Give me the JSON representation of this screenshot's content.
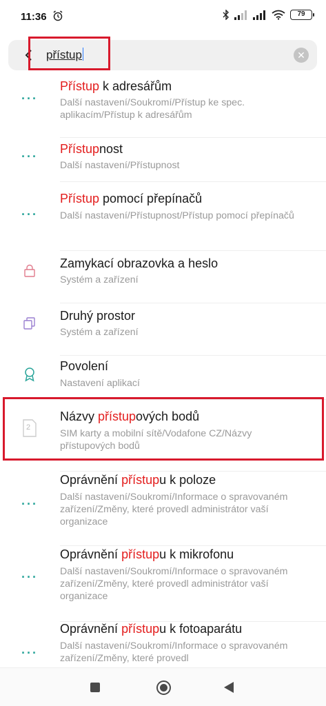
{
  "status": {
    "time": "11:36",
    "battery": "79"
  },
  "search": {
    "query": "přístup"
  },
  "results": [
    {
      "title_pre": "",
      "title_hl": "Přístup",
      "title_post": " k adresářům",
      "subtitle": "Další nastavení/Soukromí/Přístup ke spec. aplikacím/Přístup k adresářům",
      "icon": "dots-icon"
    },
    {
      "title_pre": "",
      "title_hl": "Přístup",
      "title_post": "nost",
      "subtitle": "Další nastavení/Přístupnost",
      "icon": "dots-icon"
    },
    {
      "title_pre": "",
      "title_hl": "Přístup",
      "title_post": " pomocí přepínačů",
      "subtitle": "Další nastavení/Přístupnost/Přístup pomocí přepínačů",
      "icon": "dots-icon"
    },
    {
      "title_pre": "Zamykací obrazovka a heslo",
      "title_hl": "",
      "title_post": "",
      "subtitle": "Systém a zařízení",
      "icon": "lock-icon"
    },
    {
      "title_pre": "Druhý prostor",
      "title_hl": "",
      "title_post": "",
      "subtitle": "Systém a zařízení",
      "icon": "second-space-icon"
    },
    {
      "title_pre": "Povolení",
      "title_hl": "",
      "title_post": "",
      "subtitle": "Nastavení aplikací",
      "icon": "permission-badge-icon"
    },
    {
      "title_pre": "Názvy ",
      "title_hl": "přístup",
      "title_post": "ových bodů",
      "subtitle": "SIM karty a mobilní sítě/Vodafone CZ/Názvy přístupových bodů",
      "icon": "sim-card-icon",
      "sim_number": "2"
    },
    {
      "title_pre": "Oprávnění ",
      "title_hl": "přístup",
      "title_post": "u k poloze",
      "subtitle": "Další nastavení/Soukromí/Informace o spravovaném zařízení/Změny, které provedl administrátor vaší organizace",
      "icon": "dots-icon"
    },
    {
      "title_pre": "Oprávnění ",
      "title_hl": "přístup",
      "title_post": "u k mikrofonu",
      "subtitle": "Další nastavení/Soukromí/Informace o spravovaném zařízení/Změny, které provedl administrátor vaší organizace",
      "icon": "dots-icon"
    },
    {
      "title_pre": "Oprávnění ",
      "title_hl": "přístup",
      "title_post": "u k fotoaparátu",
      "subtitle": "Další nastavení/Soukromí/Informace o spravovaném zařízení/Změny, které provedl",
      "icon": "dots-icon"
    }
  ],
  "colors": {
    "highlight": "#e31d1d",
    "annotation_box": "#d8192c",
    "accent_teal": "#2aa59a"
  }
}
